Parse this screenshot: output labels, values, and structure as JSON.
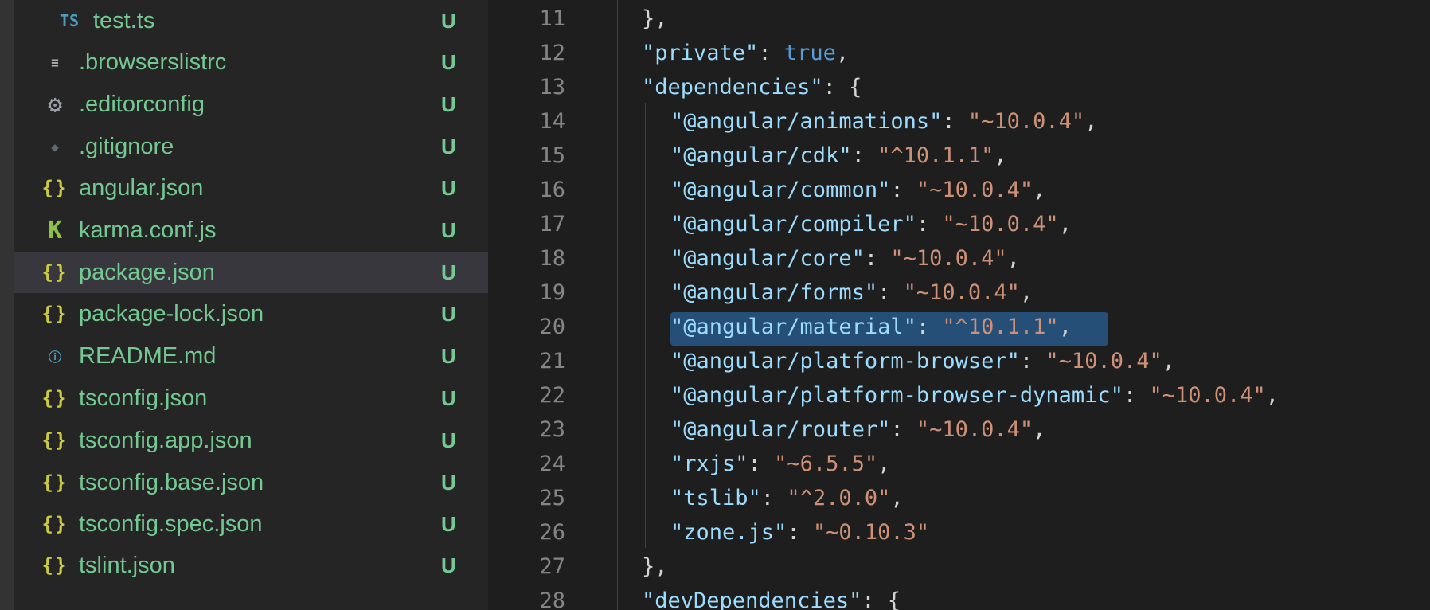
{
  "explorer": {
    "files": [
      {
        "name": "test.ts",
        "status": "U",
        "icon": "ts-icon",
        "glyph": "TS",
        "nested": true,
        "selected": false
      },
      {
        "name": ".browserslistrc",
        "status": "U",
        "icon": "text-lines-icon",
        "glyph": "≡",
        "nested": false,
        "selected": false
      },
      {
        "name": ".editorconfig",
        "status": "U",
        "icon": "gear-icon",
        "glyph": "⚙",
        "nested": false,
        "selected": false
      },
      {
        "name": ".gitignore",
        "status": "U",
        "icon": "git-icon",
        "glyph": "◆",
        "nested": false,
        "selected": false
      },
      {
        "name": "angular.json",
        "status": "U",
        "icon": "json-braces-icon",
        "glyph": "{}",
        "nested": false,
        "selected": false
      },
      {
        "name": "karma.conf.js",
        "status": "U",
        "icon": "karma-icon",
        "glyph": "K",
        "nested": false,
        "selected": false
      },
      {
        "name": "package.json",
        "status": "U",
        "icon": "json-braces-icon",
        "glyph": "{}",
        "nested": false,
        "selected": true
      },
      {
        "name": "package-lock.json",
        "status": "U",
        "icon": "json-braces-icon",
        "glyph": "{}",
        "nested": false,
        "selected": false
      },
      {
        "name": "README.md",
        "status": "U",
        "icon": "info-icon",
        "glyph": "ⓘ",
        "nested": false,
        "selected": false
      },
      {
        "name": "tsconfig.json",
        "status": "U",
        "icon": "json-braces-icon",
        "glyph": "{}",
        "nested": false,
        "selected": false
      },
      {
        "name": "tsconfig.app.json",
        "status": "U",
        "icon": "json-braces-icon",
        "glyph": "{}",
        "nested": false,
        "selected": false
      },
      {
        "name": "tsconfig.base.json",
        "status": "U",
        "icon": "json-braces-icon",
        "glyph": "{}",
        "nested": false,
        "selected": false
      },
      {
        "name": "tsconfig.spec.json",
        "status": "U",
        "icon": "json-braces-icon",
        "glyph": "{}",
        "nested": false,
        "selected": false
      },
      {
        "name": "tslint.json",
        "status": "U",
        "icon": "json-braces-icon",
        "glyph": "{}",
        "nested": false,
        "selected": false
      }
    ]
  },
  "editor": {
    "highlighted_line": 20,
    "lines": [
      {
        "num": "11",
        "indent": 1,
        "tokens": [
          {
            "t": "},",
            "c": "p"
          }
        ]
      },
      {
        "num": "12",
        "indent": 1,
        "tokens": [
          {
            "t": "\"private\"",
            "c": "k"
          },
          {
            "t": ": ",
            "c": "p"
          },
          {
            "t": "true",
            "c": "b"
          },
          {
            "t": ",",
            "c": "p"
          }
        ]
      },
      {
        "num": "13",
        "indent": 1,
        "tokens": [
          {
            "t": "\"dependencies\"",
            "c": "k"
          },
          {
            "t": ": {",
            "c": "p"
          }
        ]
      },
      {
        "num": "14",
        "indent": 2,
        "tokens": [
          {
            "t": "\"@angular/animations\"",
            "c": "k"
          },
          {
            "t": ": ",
            "c": "p"
          },
          {
            "t": "\"~10.0.4\"",
            "c": "s"
          },
          {
            "t": ",",
            "c": "p"
          }
        ]
      },
      {
        "num": "15",
        "indent": 2,
        "tokens": [
          {
            "t": "\"@angular/cdk\"",
            "c": "k"
          },
          {
            "t": ": ",
            "c": "p"
          },
          {
            "t": "\"^10.1.1\"",
            "c": "s"
          },
          {
            "t": ",",
            "c": "p"
          }
        ]
      },
      {
        "num": "16",
        "indent": 2,
        "tokens": [
          {
            "t": "\"@angular/common\"",
            "c": "k"
          },
          {
            "t": ": ",
            "c": "p"
          },
          {
            "t": "\"~10.0.4\"",
            "c": "s"
          },
          {
            "t": ",",
            "c": "p"
          }
        ]
      },
      {
        "num": "17",
        "indent": 2,
        "tokens": [
          {
            "t": "\"@angular/compiler\"",
            "c": "k"
          },
          {
            "t": ": ",
            "c": "p"
          },
          {
            "t": "\"~10.0.4\"",
            "c": "s"
          },
          {
            "t": ",",
            "c": "p"
          }
        ]
      },
      {
        "num": "18",
        "indent": 2,
        "tokens": [
          {
            "t": "\"@angular/core\"",
            "c": "k"
          },
          {
            "t": ": ",
            "c": "p"
          },
          {
            "t": "\"~10.0.4\"",
            "c": "s"
          },
          {
            "t": ",",
            "c": "p"
          }
        ]
      },
      {
        "num": "19",
        "indent": 2,
        "tokens": [
          {
            "t": "\"@angular/forms\"",
            "c": "k"
          },
          {
            "t": ": ",
            "c": "p"
          },
          {
            "t": "\"~10.0.4\"",
            "c": "s"
          },
          {
            "t": ",",
            "c": "p"
          }
        ]
      },
      {
        "num": "20",
        "indent": 2,
        "tokens": [
          {
            "t": "\"@angular/material\"",
            "c": "k"
          },
          {
            "t": ": ",
            "c": "p"
          },
          {
            "t": "\"^10.1.1\"",
            "c": "s"
          },
          {
            "t": ",",
            "c": "p"
          }
        ]
      },
      {
        "num": "21",
        "indent": 2,
        "tokens": [
          {
            "t": "\"@angular/platform-browser\"",
            "c": "k"
          },
          {
            "t": ": ",
            "c": "p"
          },
          {
            "t": "\"~10.0.4\"",
            "c": "s"
          },
          {
            "t": ",",
            "c": "p"
          }
        ]
      },
      {
        "num": "22",
        "indent": 2,
        "tokens": [
          {
            "t": "\"@angular/platform-browser-dynamic\"",
            "c": "k"
          },
          {
            "t": ": ",
            "c": "p"
          },
          {
            "t": "\"~10.0.4\"",
            "c": "s"
          },
          {
            "t": ",",
            "c": "p"
          }
        ]
      },
      {
        "num": "23",
        "indent": 2,
        "tokens": [
          {
            "t": "\"@angular/router\"",
            "c": "k"
          },
          {
            "t": ": ",
            "c": "p"
          },
          {
            "t": "\"~10.0.4\"",
            "c": "s"
          },
          {
            "t": ",",
            "c": "p"
          }
        ]
      },
      {
        "num": "24",
        "indent": 2,
        "tokens": [
          {
            "t": "\"rxjs\"",
            "c": "k"
          },
          {
            "t": ": ",
            "c": "p"
          },
          {
            "t": "\"~6.5.5\"",
            "c": "s"
          },
          {
            "t": ",",
            "c": "p"
          }
        ]
      },
      {
        "num": "25",
        "indent": 2,
        "tokens": [
          {
            "t": "\"tslib\"",
            "c": "k"
          },
          {
            "t": ": ",
            "c": "p"
          },
          {
            "t": "\"^2.0.0\"",
            "c": "s"
          },
          {
            "t": ",",
            "c": "p"
          }
        ]
      },
      {
        "num": "26",
        "indent": 2,
        "tokens": [
          {
            "t": "\"zone.js\"",
            "c": "k"
          },
          {
            "t": ": ",
            "c": "p"
          },
          {
            "t": "\"~0.10.3\"",
            "c": "s"
          }
        ]
      },
      {
        "num": "27",
        "indent": 1,
        "tokens": [
          {
            "t": "},",
            "c": "p"
          }
        ]
      },
      {
        "num": "28",
        "indent": 1,
        "tokens": [
          {
            "t": "\"devDependencies\"",
            "c": "k"
          },
          {
            "t": ": {",
            "c": "p"
          }
        ]
      }
    ]
  },
  "colors": {
    "git_untracked": "#73c991",
    "json_key": "#9cdcfe",
    "json_string": "#ce9178",
    "json_boolean": "#569cd6",
    "selection": "#264f78"
  }
}
